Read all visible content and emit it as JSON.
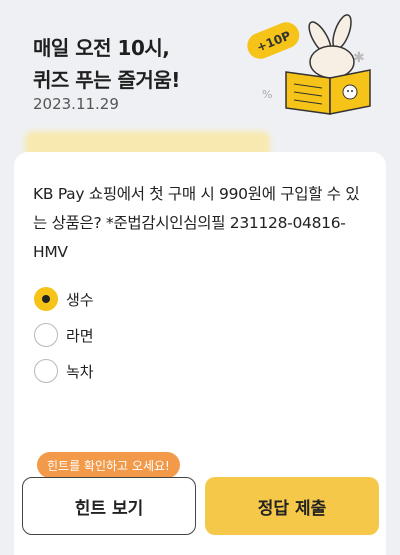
{
  "header": {
    "title_line1": "매일 오전 10시,",
    "title_line2": "퀴즈 푸는 즐거움!",
    "date": "2023.11.29",
    "badge_text": "+10P"
  },
  "question": {
    "text": "KB Pay 쇼핑에서 첫 구매 시 990원에 구입할 수 있는 상품은? *준법감시인심의필 231128-04816-HMV"
  },
  "options": [
    {
      "label": "생수",
      "selected": true
    },
    {
      "label": "라면",
      "selected": false
    },
    {
      "label": "녹차",
      "selected": false
    }
  ],
  "tooltip": "힌트를 확인하고 오세요!",
  "buttons": {
    "hint": "힌트 보기",
    "submit": "정답 제출"
  },
  "colors": {
    "accent": "#f6c84a",
    "tooltip": "#f39a4a",
    "background": "#eef0f4"
  }
}
